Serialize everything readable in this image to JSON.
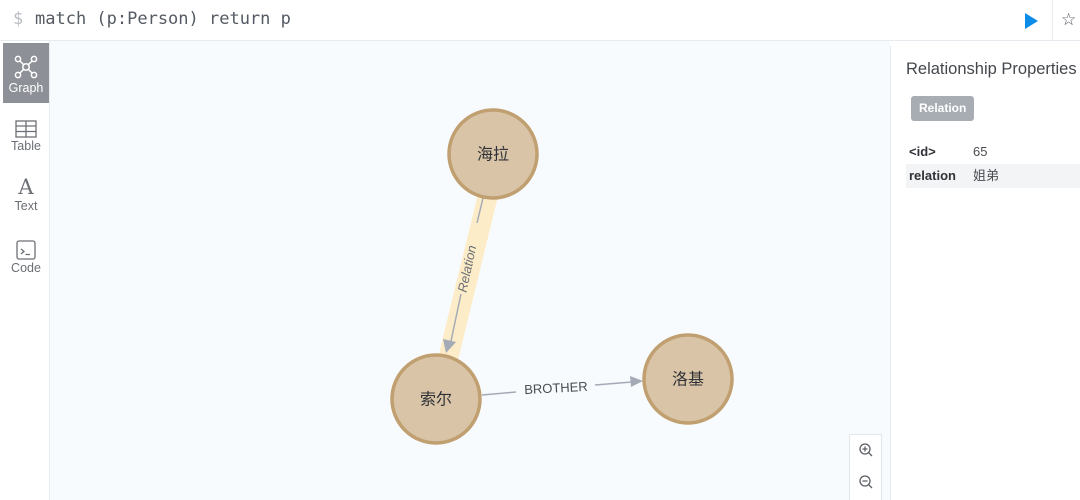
{
  "query": {
    "prompt": "$",
    "text": "match (p:Person) return p"
  },
  "toolbar": {
    "run_icon": "play-icon",
    "favorite_icon": "star-icon",
    "favorite_glyph": "☆"
  },
  "sidebar": {
    "items": [
      {
        "label": "Graph",
        "icon": "graph-icon",
        "active": true
      },
      {
        "label": "Table",
        "icon": "table-icon",
        "active": false
      },
      {
        "label": "Text",
        "icon": "text-icon",
        "active": false,
        "glyph": "A"
      },
      {
        "label": "Code",
        "icon": "code-icon",
        "active": false
      }
    ]
  },
  "graph": {
    "nodes": [
      {
        "id": "node-haila",
        "label": "海拉"
      },
      {
        "id": "node-suoer",
        "label": "索尔"
      },
      {
        "id": "node-luoji",
        "label": "洛基"
      }
    ],
    "relationships": [
      {
        "from": "node-haila",
        "to": "node-suoer",
        "type": "Relation",
        "selected": true
      },
      {
        "from": "node-suoer",
        "to": "node-luoji",
        "type": "BROTHER",
        "selected": false
      }
    ],
    "colors": {
      "node_fill": "#d9c4a7",
      "node_stroke": "#c09f70",
      "rel_line": "#a5abb6",
      "selection_halo": "#fdecc8"
    }
  },
  "zoom": {
    "in_icon": "zoom-in-icon",
    "out_icon": "zoom-out-icon"
  },
  "inspector": {
    "title": "Relationship Properties",
    "badge": "Relation",
    "properties": [
      {
        "key": "<id>",
        "value": "65"
      },
      {
        "key": "relation",
        "value": "姐弟"
      }
    ]
  }
}
